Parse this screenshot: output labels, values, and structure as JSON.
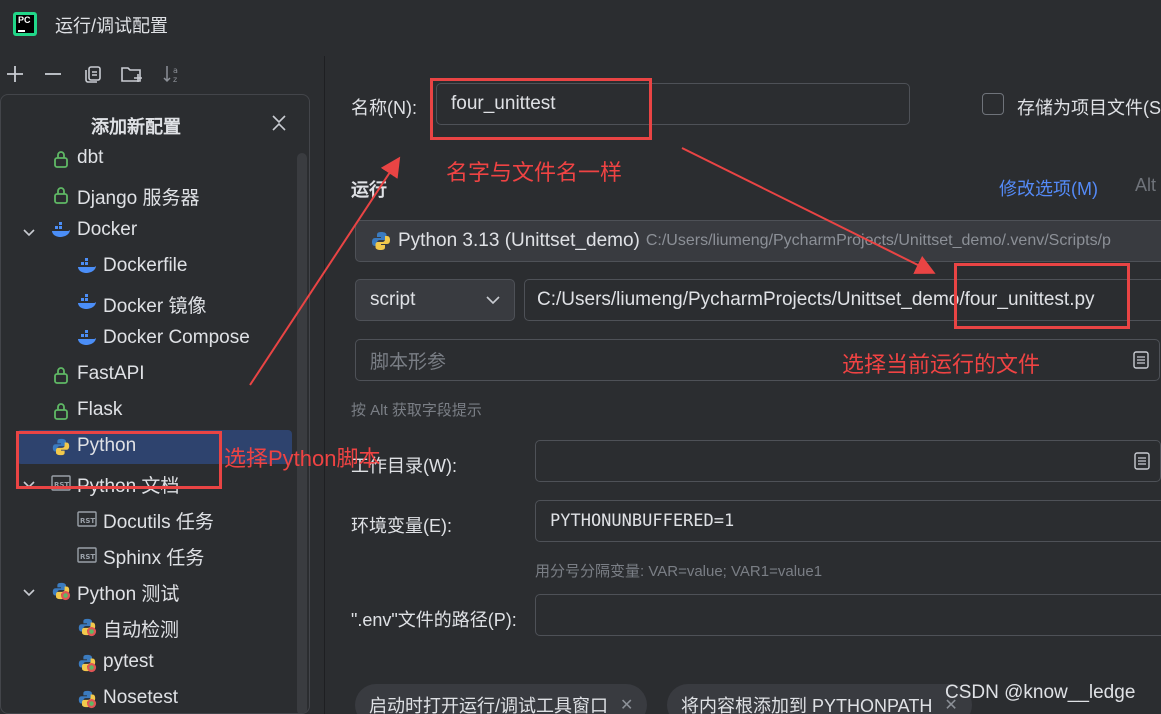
{
  "window": {
    "title": "运行/调试配置"
  },
  "toolbar": {
    "icons": [
      "plus-icon",
      "minus-icon",
      "copy-icon",
      "new-folder-icon",
      "sort-icon"
    ]
  },
  "left_panel": {
    "header": "添加新配置",
    "items": [
      {
        "label": "dbt",
        "icon": "lock-icon"
      },
      {
        "label": "Django 服务器",
        "icon": "lock-icon"
      },
      {
        "label": "Docker",
        "icon": "docker-icon",
        "expanded": true
      },
      {
        "label": "Dockerfile",
        "icon": "docker-icon"
      },
      {
        "label": "Docker 镜像",
        "icon": "docker-icon"
      },
      {
        "label": "Docker Compose",
        "icon": "docker-icon"
      },
      {
        "label": "FastAPI",
        "icon": "lock-icon"
      },
      {
        "label": "Flask",
        "icon": "lock-icon"
      },
      {
        "label": "Python",
        "icon": "python-icon",
        "selected": true
      },
      {
        "label": "Python 文档",
        "icon": "rst-icon",
        "expanded": true
      },
      {
        "label": "Docutils 任务",
        "icon": "rst-icon"
      },
      {
        "label": "Sphinx 任务",
        "icon": "rst-icon"
      },
      {
        "label": "Python 测试",
        "icon": "python-test-icon",
        "expanded": true
      },
      {
        "label": "自动检测",
        "icon": "python-test-icon"
      },
      {
        "label": "pytest",
        "icon": "python-test-icon"
      },
      {
        "label": "Nosetest",
        "icon": "python-test-icon"
      }
    ]
  },
  "form": {
    "name_label": "名称(N):",
    "name_value": "four_unittest",
    "store_label": "存储为项目文件(S)",
    "run_section": "运行",
    "modify_options": "修改选项(M)",
    "modify_shortcut": "Alt",
    "interpreter_name": "Python 3.13 (Unittset_demo)",
    "interpreter_path": "C:/Users/liumeng/PycharmProjects/Unittset_demo/.venv/Scripts/p",
    "script_type": "script",
    "script_path": "C:/Users/liumeng/PycharmProjects/Unittset_demo/four_unittest.py",
    "script_params_placeholder": "脚本形参",
    "alt_hint": "按 Alt 获取字段提示",
    "workdir_label": "工作目录(W):",
    "workdir_value": "",
    "env_label": "环境变量(E):",
    "env_value": "PYTHONUNBUFFERED=1",
    "env_hint": "用分号分隔变量: VAR=value; VAR1=value1",
    "dotenv_label": "\".env\"文件的路径(P):",
    "dotenv_value": "",
    "chips": [
      "启动时打开运行/调试工具窗口",
      "将内容根添加到 PYTHONPATH"
    ]
  },
  "annotations": {
    "same_name": "名字与文件名一样",
    "choose_file": "选择当前运行的文件",
    "choose_python": "选择Python脚本"
  },
  "watermark": "CSDN @know__ledge",
  "colors": {
    "accent": "#548af7",
    "selection": "#2e436e",
    "annotation": "#e94444"
  }
}
